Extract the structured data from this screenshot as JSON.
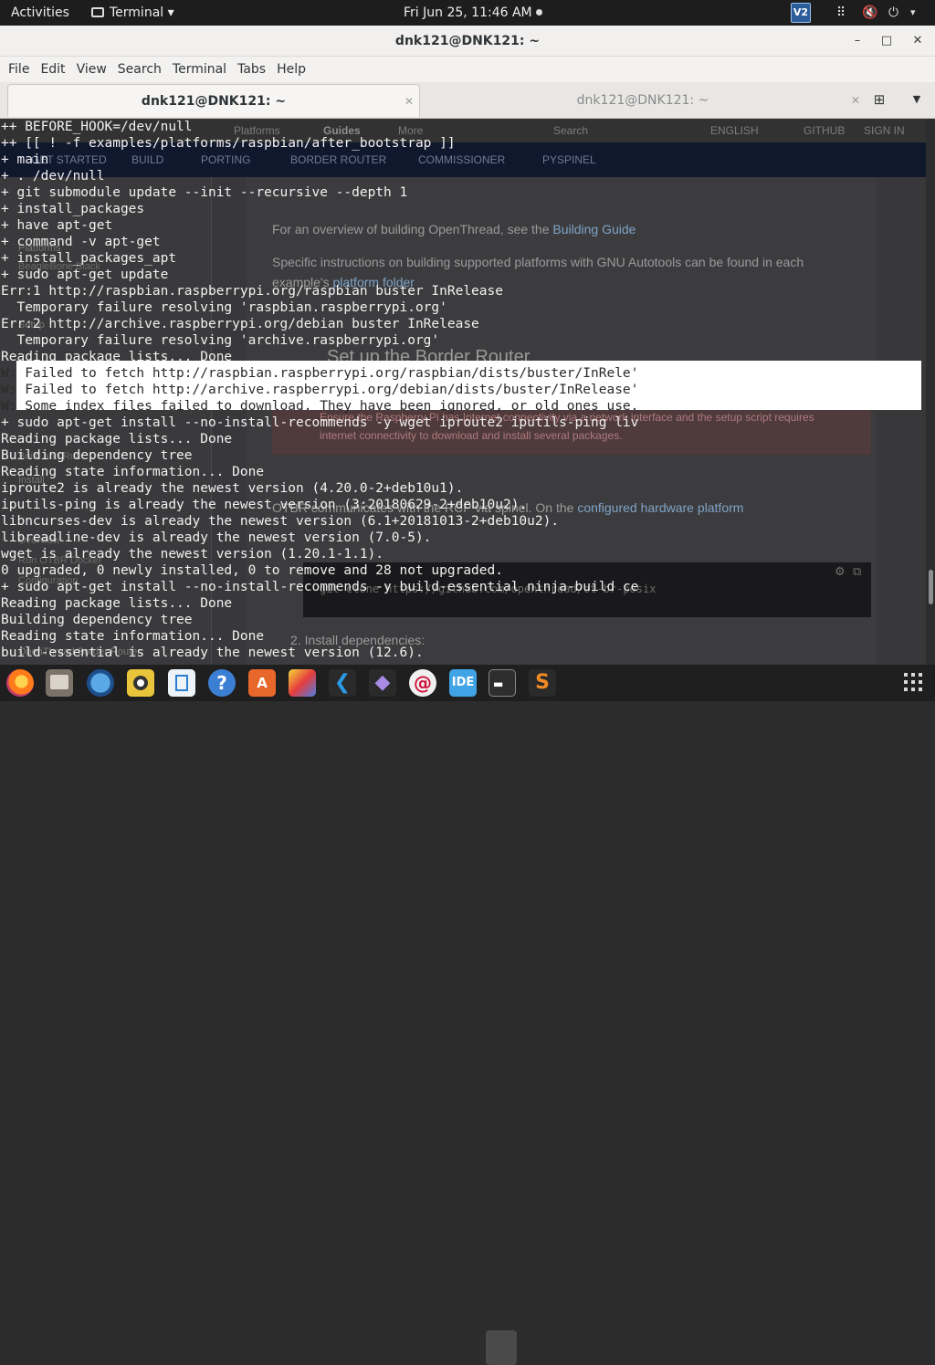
{
  "topbar": {
    "activities": "Activities",
    "app_name": "Terminal",
    "clock": "Fri Jun 25, 11:46 AM",
    "vpn_label": "V2"
  },
  "window": {
    "title": "dnk121@DNK121: ~",
    "minimize": "–",
    "maximize": "□",
    "close": "✕"
  },
  "menubar": {
    "items": [
      "File",
      "Edit",
      "View",
      "Search",
      "Terminal",
      "Tabs",
      "Help"
    ]
  },
  "tabs": [
    {
      "label": "dnk121@DNK121: ~",
      "active": true
    },
    {
      "label": "dnk121@DNK121: ~",
      "active": false
    }
  ],
  "background_page": {
    "top_links": [
      "Platforms",
      "Guides",
      "More",
      "Search",
      "ENGLISH",
      "GITHUB",
      "SIGN IN"
    ],
    "nav_items": [
      "GET STARTED",
      "BUILD",
      "PORTING",
      "BORDER ROUTER",
      "COMMISSIONER",
      "PYSPINEL"
    ],
    "sidebar_items": [
      "Platforms",
      "BeagleBone Black",
      "Setup",
      "Build and Run",
      "Install",
      "Overview",
      "Run OTBR Docker",
      "Configuration",
      "OpenThread Border Router"
    ],
    "para1_a": "For an overview of building OpenThread, see the ",
    "para1_link": "Building Guide",
    "para2_a": "Specific instructions on building supported platforms with GNU Autotools can be found in each",
    "para2_b": "example's ",
    "para2_link": "platform folder",
    "heading": "Set up the Border Router",
    "warn_a": "Ensure the Raspberry Pi has Internet connectivity via a network interface and the setup script requires",
    "warn_b": "internet connectivity to download and install several packages.",
    "para3_a": "OTBR communicates with the RCP via spinel. On the ",
    "para3_link": "configured hardware platform",
    "code1": "git clone https://github.com/openthread/ot-br-posix",
    "step2": "2. Install dependencies:"
  },
  "terminal_lines": [
    "++ BEFORE_HOOK=/dev/null",
    "++ [[ ! -f examples/platforms/raspbian/after_bootstrap ]]",
    "+ main",
    "+ . /dev/null",
    "+ git submodule update --init --recursive --depth 1",
    "+ install_packages",
    "+ have apt-get",
    "+ command -v apt-get",
    "+ install_packages_apt",
    "+ sudo apt-get update",
    "Err:1 http://raspbian.raspberrypi.org/raspbian buster InRelease",
    "  Temporary failure resolving 'raspbian.raspberrypi.org'",
    "Err:2 http://archive.raspberrypi.org/debian buster InRelease",
    "  Temporary failure resolving 'archive.raspberrypi.org'",
    "Reading package lists... Done",
    "W: Failed to fetch http://raspbian.raspberrypi.org/raspbian/dists/buster/InRele'",
    "W: Failed to fetch http://archive.raspberrypi.org/debian/dists/buster/InRelease'",
    "W: Some index files failed to download. They have been ignored, or old ones use.",
    "+ sudo apt-get install --no-install-recommends -y wget iproute2 iputils-ping liv",
    "Reading package lists... Done",
    "Building dependency tree",
    "Reading state information... Done",
    "iproute2 is already the newest version (4.20.0-2+deb10u1).",
    "iputils-ping is already the newest version (3:20180629-2+deb10u2).",
    "libncurses-dev is already the newest version (6.1+20181013-2+deb10u2).",
    "libreadline-dev is already the newest version (7.0-5).",
    "wget is already the newest version (1.20.1-1.1).",
    "0 upgraded, 0 newly installed, 0 to remove and 28 not upgraded.",
    "+ sudo apt-get install --no-install-recommends -y build-essential ninja-build ce",
    "Reading package lists... Done",
    "Building dependency tree",
    "Reading state information... Done",
    "build-essential is already the newest version (12.6)."
  ],
  "dock": {
    "apps": [
      "firefox-icon",
      "files-icon",
      "thunderbird-icon",
      "rhythmbox-icon",
      "libreoffice-writer-icon",
      "help-icon",
      "software-center-icon",
      "image-editor-icon",
      "vscode-icon",
      "extensions-icon",
      "debian-icon",
      "ide-icon",
      "terminal-icon",
      "sublime-icon"
    ],
    "ide_label": "IDE"
  }
}
